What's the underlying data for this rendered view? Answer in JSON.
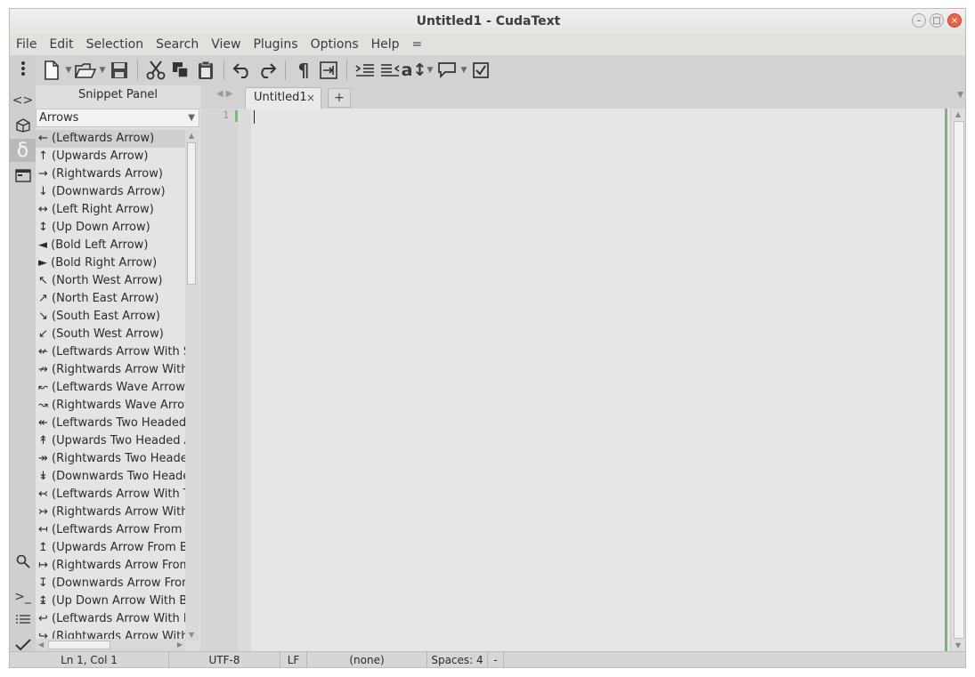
{
  "window": {
    "title": "Untitled1 - CudaText"
  },
  "menu": [
    "File",
    "Edit",
    "Selection",
    "Search",
    "View",
    "Plugins",
    "Options",
    "Help",
    "="
  ],
  "toolbar": {
    "icons": [
      "new-file-icon",
      "open-file-icon",
      "save-icon",
      "cut-icon",
      "copy-icon",
      "paste-icon",
      "undo-icon",
      "redo-icon",
      "paragraph-marks-icon",
      "wrap-icon",
      "indent-icon",
      "unindent-icon",
      "case-icon",
      "comment-icon",
      "check-icon"
    ]
  },
  "sidebar": {
    "icons": [
      "menu-dots-icon",
      "code-tree-icon",
      "project-icon",
      "snippet-panel-icon",
      "tabs-icon",
      "search-icon",
      "console-icon",
      "list-icon",
      "validate-icon"
    ],
    "active": "snippet-panel-icon"
  },
  "snippet_panel": {
    "title": "Snippet Panel",
    "category": "Arrows",
    "items": [
      "← (Leftwards Arrow)",
      "↑ (Upwards Arrow)",
      "→ (Rightwards Arrow)",
      "↓ (Downwards Arrow)",
      "↔ (Left Right Arrow)",
      "↕ (Up Down Arrow)",
      "◄ (Bold Left Arrow)",
      "► (Bold Right Arrow)",
      "↖ (North West Arrow)",
      "↗ (North East Arrow)",
      "↘ (South East Arrow)",
      "↙ (South West Arrow)",
      "↚ (Leftwards Arrow With Stroke)",
      "↛ (Rightwards Arrow With Stroke)",
      "↜ (Leftwards Wave Arrow)",
      "↝ (Rightwards Wave Arrow)",
      "↞ (Leftwards Two Headed Arrow)",
      "↟ (Upwards Two Headed Arrow)",
      "↠ (Rightwards Two Headed Arrow)",
      "↡ (Downwards Two Headed Arrow)",
      "↢ (Leftwards Arrow With Tail)",
      "↣ (Rightwards Arrow With Tail)",
      "↤ (Leftwards Arrow From Bar)",
      "↥ (Upwards Arrow From Bar)",
      "↦ (Rightwards Arrow From Bar)",
      "↧ (Downwards Arrow From Bar)",
      "↨ (Up Down Arrow With Base)",
      "↩ (Leftwards Arrow With Hook)",
      "↪ (Rightwards Arrow With Hook)"
    ],
    "selected_index": 0
  },
  "tabs": {
    "items": [
      "Untitled1"
    ],
    "close_glyph": "×",
    "add_glyph": "+"
  },
  "editor": {
    "line_numbers": [
      "1"
    ]
  },
  "status": {
    "position": "Ln 1, Col 1",
    "encoding": "UTF-8",
    "line_ending": "LF",
    "lexer": "(none)",
    "indent": "Spaces: 4",
    "extra": "-"
  }
}
